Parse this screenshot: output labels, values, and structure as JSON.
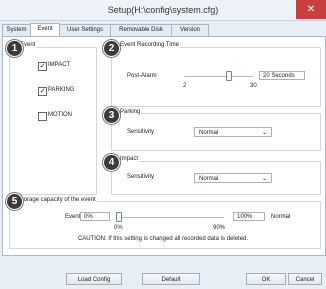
{
  "window": {
    "title": "Setup(H:\\config\\system.cfg)"
  },
  "tabs": [
    "System",
    "Event",
    "User Settings",
    "Removable Disk",
    "Version"
  ],
  "event_group": {
    "title": "Event",
    "items": [
      {
        "label": "IMPACT",
        "checked": true
      },
      {
        "label": "PARKING",
        "checked": true
      },
      {
        "label": "MOTION",
        "checked": false
      }
    ]
  },
  "recording_time": {
    "title": "Event Recording Time",
    "label": "Post-Alarm",
    "min_label": "2",
    "max_label": "30",
    "value_text": "20 Seconds",
    "slider_fraction": 0.64
  },
  "parking": {
    "title": "Parking",
    "label": "Sensitivity",
    "value": "Normal"
  },
  "impact": {
    "title": "Impact",
    "label": "Sensitivity",
    "value": "Normal"
  },
  "storage": {
    "title": "Storage capacity of the event",
    "label": "Event",
    "left_value": "0%",
    "min_label": "0%",
    "max_label": "90%",
    "value_text": "100%",
    "status": "Normal",
    "caution": "CAUTION: If this setting is changed all recorded data is deleted."
  },
  "badges": [
    "1",
    "2",
    "3",
    "4",
    "5"
  ],
  "buttons": {
    "load": "Load Config",
    "default": "Default",
    "ok": "OK",
    "cancel": "Cancel"
  }
}
